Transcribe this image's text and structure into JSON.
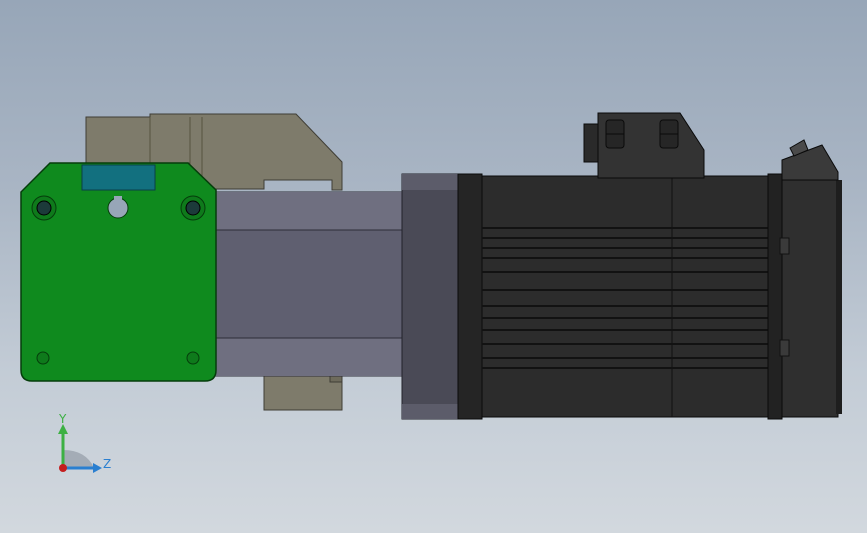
{
  "viewport": {
    "background_top": "#97a6b8",
    "background_bottom": "#d2d8de"
  },
  "model": {
    "parts": [
      "mounting-bracket",
      "green-adapter-plate",
      "coupling-housing",
      "gearbox-flange",
      "servo-motor-body",
      "connector-box",
      "encoder-cap"
    ],
    "colors": {
      "bracket": "#7e7b6b",
      "plate": "#0f8a1e",
      "plate_tab": "#12707f",
      "housing": "#5f5f70",
      "motor": "#2c2c2c"
    }
  },
  "triad": {
    "y_label": "Y",
    "z_label": "Z"
  }
}
